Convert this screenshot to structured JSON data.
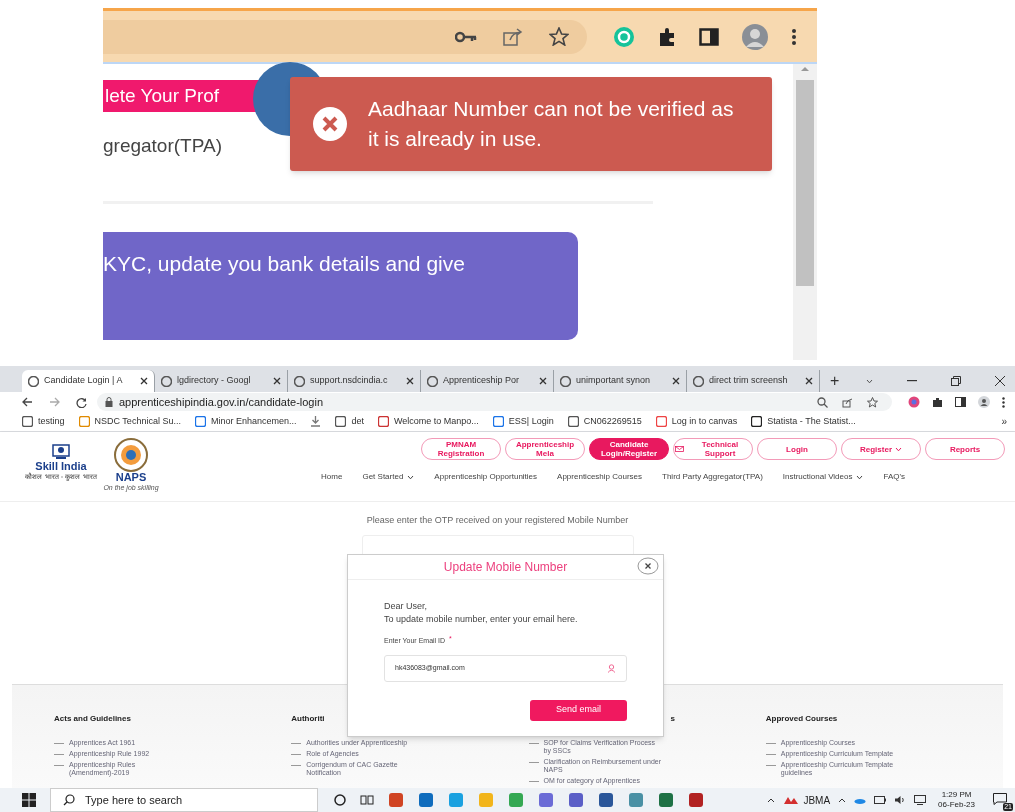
{
  "top_capture": {
    "profile_button": "lete Your Prof",
    "nav_text": "gregator(TPA)",
    "toast": {
      "message": "Aadhaar Number can not be verified as it is already in use."
    },
    "banner": "KYC, update you bank details and give"
  },
  "browser": {
    "tabs": [
      {
        "label": "Candidate Login | A",
        "selected": true
      },
      {
        "label": "lgdirectory - Googl",
        "selected": false
      },
      {
        "label": "support.nsdcindia.c",
        "selected": false
      },
      {
        "label": "Apprenticeship Por",
        "selected": false
      },
      {
        "label": "unimportant synon",
        "selected": false
      },
      {
        "label": "direct trim screensh",
        "selected": false
      }
    ],
    "new_tab": "+",
    "address": "apprenticeshipindia.gov.in/candidate-login",
    "bookmarks": [
      {
        "kind": "link",
        "label": "testing"
      },
      {
        "kind": "link",
        "label": "NSDC Technical Su..."
      },
      {
        "kind": "link",
        "label": "Minor Enhancemen..."
      },
      {
        "kind": "icon"
      },
      {
        "kind": "link",
        "label": "det"
      },
      {
        "kind": "link",
        "label": "Welcome to Manpo..."
      },
      {
        "kind": "link",
        "label": "ESS| Login"
      },
      {
        "kind": "link",
        "label": "CN062269515"
      },
      {
        "kind": "link",
        "label": "Log in to canvas"
      },
      {
        "kind": "link",
        "label": "Statista - The Statist..."
      }
    ],
    "more_bookmarks": "»"
  },
  "site": {
    "skill_india": "Skill India",
    "skill_india_tagline": "कौशल भारत - कुशल भारत",
    "naps": "NAPS",
    "naps_tagline": "On the job skilling",
    "top_buttons": [
      {
        "label": "PMNAM Registration",
        "selected": false,
        "dropdown": false
      },
      {
        "label": "Apprenticeship Mela",
        "selected": false,
        "dropdown": false
      },
      {
        "label": "Candidate Login/Register",
        "selected": true,
        "dropdown": false
      },
      {
        "label": "Technical Support",
        "selected": false,
        "dropdown": false
      },
      {
        "label": "Login",
        "selected": false,
        "dropdown": false
      },
      {
        "label": "Register",
        "selected": false,
        "dropdown": true
      },
      {
        "label": "Reports",
        "selected": false,
        "dropdown": false
      }
    ],
    "nav": [
      {
        "label": "Home",
        "dropdown": false
      },
      {
        "label": "Get Started",
        "dropdown": true
      },
      {
        "label": "Apprenticeship Opportunities",
        "dropdown": false
      },
      {
        "label": "Apprenticeship Courses",
        "dropdown": false
      },
      {
        "label": "Third Party Aggregator(TPA)",
        "dropdown": false
      },
      {
        "label": "Instructional Videos",
        "dropdown": true
      },
      {
        "label": "FAQ's",
        "dropdown": false
      }
    ]
  },
  "otp_prompt": "Please enter the OTP received on your registered Mobile Number",
  "modal": {
    "title": "Update Mobile Number",
    "greeting": "Dear User,",
    "instruction": "To update mobile number, enter your email here.",
    "field_label": "Enter Your Email ID",
    "required_mark": "*",
    "email": "hk436083@gmail.com",
    "button": "Send email"
  },
  "footer": {
    "columns": [
      {
        "heading": "Acts and Guidelines",
        "links": [
          "Apprentices Act 1961",
          "Apprenticeship Rule 1992",
          "Apprenticeship Rules (Amendment)-2019"
        ]
      },
      {
        "heading": "Authoriti",
        "links": [
          "Authorities under Apprenticeship",
          "Role of Agencies",
          "Corrigendum of CAC Gazette Notification"
        ]
      },
      {
        "heading": "s",
        "links": [
          "SOP for Claims Verification Process by SSCs",
          "Clarification on Reimbursement under NAPS",
          "OM for category of Apprentices"
        ]
      },
      {
        "heading": "Approved Courses",
        "links": [
          "Apprenticeship Courses",
          "Apprenticeship Curriculum Template",
          "Apprenticeship Curriculum Template guidelines"
        ]
      }
    ]
  },
  "taskbar": {
    "search_placeholder": "Type here to search",
    "tray_label": "JBMA",
    "time": "1:29 PM",
    "date": "06-Feb-23",
    "notifications": "21"
  }
}
